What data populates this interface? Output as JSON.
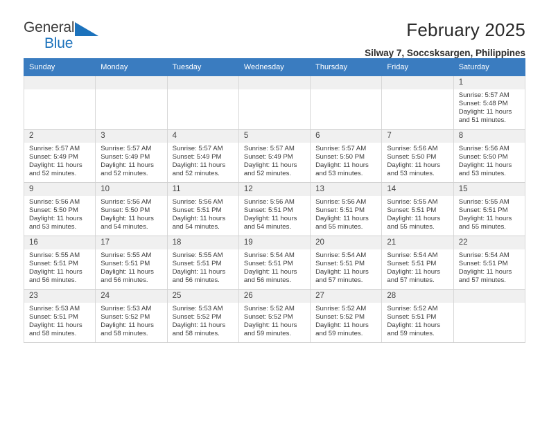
{
  "brand": {
    "name_part1": "General",
    "name_part2": "Blue",
    "logo_icon": "triangle-logo-icon",
    "accent_color": "#1c72bc"
  },
  "header": {
    "title": "February 2025",
    "subtitle": "Silway 7, Soccsksargen, Philippines"
  },
  "calendar": {
    "header_bg": "#3a7cc0",
    "weekday_headers": [
      "Sunday",
      "Monday",
      "Tuesday",
      "Wednesday",
      "Thursday",
      "Friday",
      "Saturday"
    ],
    "weeks": [
      [
        {
          "day": "",
          "sunrise": "",
          "sunset": "",
          "daylight_line1": "",
          "daylight_line2": "",
          "empty": true
        },
        {
          "day": "",
          "sunrise": "",
          "sunset": "",
          "daylight_line1": "",
          "daylight_line2": "",
          "empty": true
        },
        {
          "day": "",
          "sunrise": "",
          "sunset": "",
          "daylight_line1": "",
          "daylight_line2": "",
          "empty": true
        },
        {
          "day": "",
          "sunrise": "",
          "sunset": "",
          "daylight_line1": "",
          "daylight_line2": "",
          "empty": true
        },
        {
          "day": "",
          "sunrise": "",
          "sunset": "",
          "daylight_line1": "",
          "daylight_line2": "",
          "empty": true
        },
        {
          "day": "",
          "sunrise": "",
          "sunset": "",
          "daylight_line1": "",
          "daylight_line2": "",
          "empty": true
        },
        {
          "day": "1",
          "sunrise": "Sunrise: 5:57 AM",
          "sunset": "Sunset: 5:48 PM",
          "daylight_line1": "Daylight: 11 hours",
          "daylight_line2": "and 51 minutes."
        }
      ],
      [
        {
          "day": "2",
          "sunrise": "Sunrise: 5:57 AM",
          "sunset": "Sunset: 5:49 PM",
          "daylight_line1": "Daylight: 11 hours",
          "daylight_line2": "and 52 minutes."
        },
        {
          "day": "3",
          "sunrise": "Sunrise: 5:57 AM",
          "sunset": "Sunset: 5:49 PM",
          "daylight_line1": "Daylight: 11 hours",
          "daylight_line2": "and 52 minutes."
        },
        {
          "day": "4",
          "sunrise": "Sunrise: 5:57 AM",
          "sunset": "Sunset: 5:49 PM",
          "daylight_line1": "Daylight: 11 hours",
          "daylight_line2": "and 52 minutes."
        },
        {
          "day": "5",
          "sunrise": "Sunrise: 5:57 AM",
          "sunset": "Sunset: 5:49 PM",
          "daylight_line1": "Daylight: 11 hours",
          "daylight_line2": "and 52 minutes."
        },
        {
          "day": "6",
          "sunrise": "Sunrise: 5:57 AM",
          "sunset": "Sunset: 5:50 PM",
          "daylight_line1": "Daylight: 11 hours",
          "daylight_line2": "and 53 minutes."
        },
        {
          "day": "7",
          "sunrise": "Sunrise: 5:56 AM",
          "sunset": "Sunset: 5:50 PM",
          "daylight_line1": "Daylight: 11 hours",
          "daylight_line2": "and 53 minutes."
        },
        {
          "day": "8",
          "sunrise": "Sunrise: 5:56 AM",
          "sunset": "Sunset: 5:50 PM",
          "daylight_line1": "Daylight: 11 hours",
          "daylight_line2": "and 53 minutes."
        }
      ],
      [
        {
          "day": "9",
          "sunrise": "Sunrise: 5:56 AM",
          "sunset": "Sunset: 5:50 PM",
          "daylight_line1": "Daylight: 11 hours",
          "daylight_line2": "and 53 minutes."
        },
        {
          "day": "10",
          "sunrise": "Sunrise: 5:56 AM",
          "sunset": "Sunset: 5:50 PM",
          "daylight_line1": "Daylight: 11 hours",
          "daylight_line2": "and 54 minutes."
        },
        {
          "day": "11",
          "sunrise": "Sunrise: 5:56 AM",
          "sunset": "Sunset: 5:51 PM",
          "daylight_line1": "Daylight: 11 hours",
          "daylight_line2": "and 54 minutes."
        },
        {
          "day": "12",
          "sunrise": "Sunrise: 5:56 AM",
          "sunset": "Sunset: 5:51 PM",
          "daylight_line1": "Daylight: 11 hours",
          "daylight_line2": "and 54 minutes."
        },
        {
          "day": "13",
          "sunrise": "Sunrise: 5:56 AM",
          "sunset": "Sunset: 5:51 PM",
          "daylight_line1": "Daylight: 11 hours",
          "daylight_line2": "and 55 minutes."
        },
        {
          "day": "14",
          "sunrise": "Sunrise: 5:55 AM",
          "sunset": "Sunset: 5:51 PM",
          "daylight_line1": "Daylight: 11 hours",
          "daylight_line2": "and 55 minutes."
        },
        {
          "day": "15",
          "sunrise": "Sunrise: 5:55 AM",
          "sunset": "Sunset: 5:51 PM",
          "daylight_line1": "Daylight: 11 hours",
          "daylight_line2": "and 55 minutes."
        }
      ],
      [
        {
          "day": "16",
          "sunrise": "Sunrise: 5:55 AM",
          "sunset": "Sunset: 5:51 PM",
          "daylight_line1": "Daylight: 11 hours",
          "daylight_line2": "and 56 minutes."
        },
        {
          "day": "17",
          "sunrise": "Sunrise: 5:55 AM",
          "sunset": "Sunset: 5:51 PM",
          "daylight_line1": "Daylight: 11 hours",
          "daylight_line2": "and 56 minutes."
        },
        {
          "day": "18",
          "sunrise": "Sunrise: 5:55 AM",
          "sunset": "Sunset: 5:51 PM",
          "daylight_line1": "Daylight: 11 hours",
          "daylight_line2": "and 56 minutes."
        },
        {
          "day": "19",
          "sunrise": "Sunrise: 5:54 AM",
          "sunset": "Sunset: 5:51 PM",
          "daylight_line1": "Daylight: 11 hours",
          "daylight_line2": "and 56 minutes."
        },
        {
          "day": "20",
          "sunrise": "Sunrise: 5:54 AM",
          "sunset": "Sunset: 5:51 PM",
          "daylight_line1": "Daylight: 11 hours",
          "daylight_line2": "and 57 minutes."
        },
        {
          "day": "21",
          "sunrise": "Sunrise: 5:54 AM",
          "sunset": "Sunset: 5:51 PM",
          "daylight_line1": "Daylight: 11 hours",
          "daylight_line2": "and 57 minutes."
        },
        {
          "day": "22",
          "sunrise": "Sunrise: 5:54 AM",
          "sunset": "Sunset: 5:51 PM",
          "daylight_line1": "Daylight: 11 hours",
          "daylight_line2": "and 57 minutes."
        }
      ],
      [
        {
          "day": "23",
          "sunrise": "Sunrise: 5:53 AM",
          "sunset": "Sunset: 5:51 PM",
          "daylight_line1": "Daylight: 11 hours",
          "daylight_line2": "and 58 minutes."
        },
        {
          "day": "24",
          "sunrise": "Sunrise: 5:53 AM",
          "sunset": "Sunset: 5:52 PM",
          "daylight_line1": "Daylight: 11 hours",
          "daylight_line2": "and 58 minutes."
        },
        {
          "day": "25",
          "sunrise": "Sunrise: 5:53 AM",
          "sunset": "Sunset: 5:52 PM",
          "daylight_line1": "Daylight: 11 hours",
          "daylight_line2": "and 58 minutes."
        },
        {
          "day": "26",
          "sunrise": "Sunrise: 5:52 AM",
          "sunset": "Sunset: 5:52 PM",
          "daylight_line1": "Daylight: 11 hours",
          "daylight_line2": "and 59 minutes."
        },
        {
          "day": "27",
          "sunrise": "Sunrise: 5:52 AM",
          "sunset": "Sunset: 5:52 PM",
          "daylight_line1": "Daylight: 11 hours",
          "daylight_line2": "and 59 minutes."
        },
        {
          "day": "28",
          "sunrise": "Sunrise: 5:52 AM",
          "sunset": "Sunset: 5:51 PM",
          "daylight_line1": "Daylight: 11 hours",
          "daylight_line2": "and 59 minutes."
        },
        {
          "day": "",
          "sunrise": "",
          "sunset": "",
          "daylight_line1": "",
          "daylight_line2": "",
          "empty": true
        }
      ]
    ]
  }
}
